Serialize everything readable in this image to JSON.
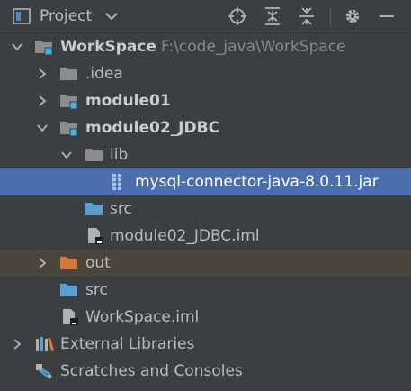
{
  "header": {
    "title": "Project",
    "icons": [
      "project-view-icon",
      "chevron-down-icon",
      "locate-icon",
      "expand-all-icon",
      "collapse-all-icon",
      "gear-icon",
      "minimize-icon"
    ]
  },
  "tree": {
    "workspace": {
      "label": "WorkSpace",
      "path": "F:\\code_java\\WorkSpace"
    },
    "idea": {
      "label": ".idea"
    },
    "module01": {
      "label": "module01"
    },
    "module02": {
      "label": "module02_JDBC"
    },
    "lib": {
      "label": "lib"
    },
    "jar": {
      "label": "mysql-connector-java-8.0.11.jar"
    },
    "module02_src": {
      "label": "src"
    },
    "module02_iml": {
      "label": "module02_JDBC.iml"
    },
    "out": {
      "label": "out"
    },
    "src": {
      "label": "src"
    },
    "workspace_iml": {
      "label": "WorkSpace.iml"
    },
    "external_libraries": {
      "label": "External Libraries"
    },
    "scratches": {
      "label": "Scratches and Consoles"
    }
  },
  "colors": {
    "background": "#3c3f41",
    "selection": "#4b6eaf",
    "excluded_row": "#4a453a",
    "folder_blue": "#5a9fd4",
    "folder_gray": "#8c8c8c",
    "folder_orange": "#d4773a"
  }
}
